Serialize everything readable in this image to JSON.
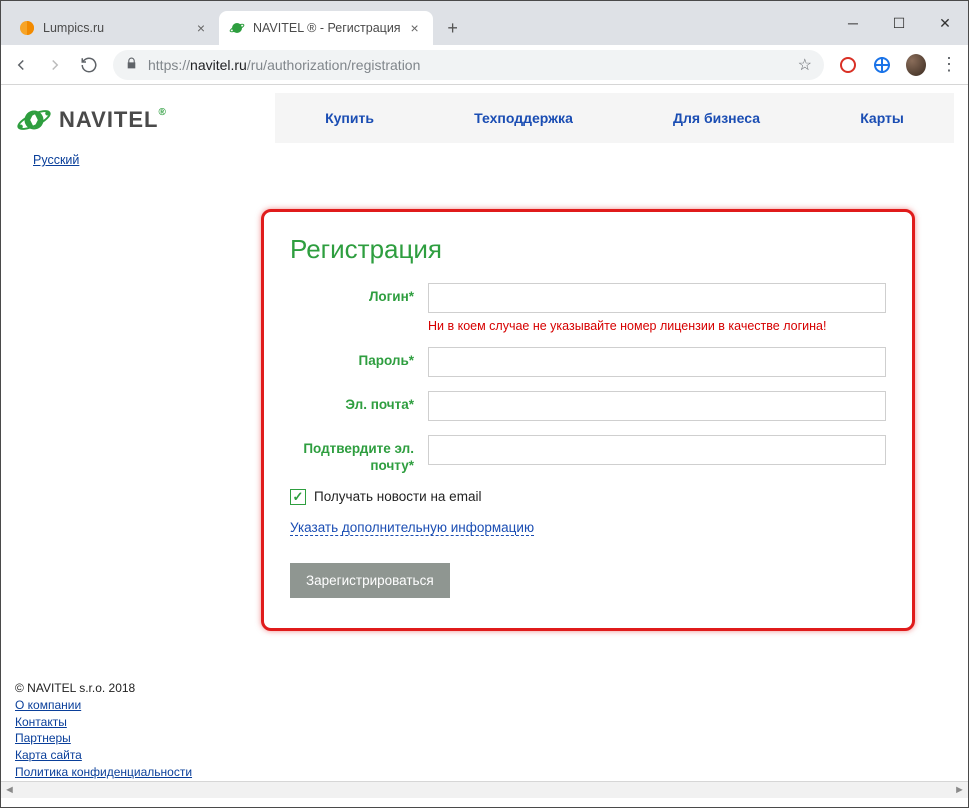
{
  "browser": {
    "tabs": [
      {
        "title": "Lumpics.ru",
        "active": false
      },
      {
        "title": "NAVITEL ® - Регистрация",
        "active": true
      }
    ],
    "url_grey_prefix": "https://",
    "url_host": "navitel.ru",
    "url_path": "/ru/authorization/registration"
  },
  "logo": {
    "text": "NAVITEL",
    "reg": "®"
  },
  "language_link": "Русский",
  "nav": {
    "buy": "Купить",
    "support": "Техподдержка",
    "business": "Для бизнеса",
    "maps": "Карты"
  },
  "form": {
    "title": "Регистрация",
    "login_label": "Логин*",
    "login_value": "",
    "login_hint": "Ни в коем случае не указывайте номер лицензии в качестве логина!",
    "password_label": "Пароль*",
    "password_value": "",
    "email_label": "Эл. почта*",
    "email_value": "",
    "email_confirm_label": "Подтвердите эл. почту*",
    "email_confirm_value": "",
    "news_checkbox_label": "Получать новости на email",
    "news_checkbox_mark": "✓",
    "extra_info_link": "Указать дополнительную информацию",
    "submit_label": "Зарегистрироваться"
  },
  "footer": {
    "copyright": "© NAVITEL s.r.o. 2018",
    "links": {
      "about": "О компании",
      "contacts": "Контакты",
      "partners": "Партнеры",
      "sitemap": "Карта сайта",
      "privacy": "Политика конфиденциальности"
    }
  }
}
